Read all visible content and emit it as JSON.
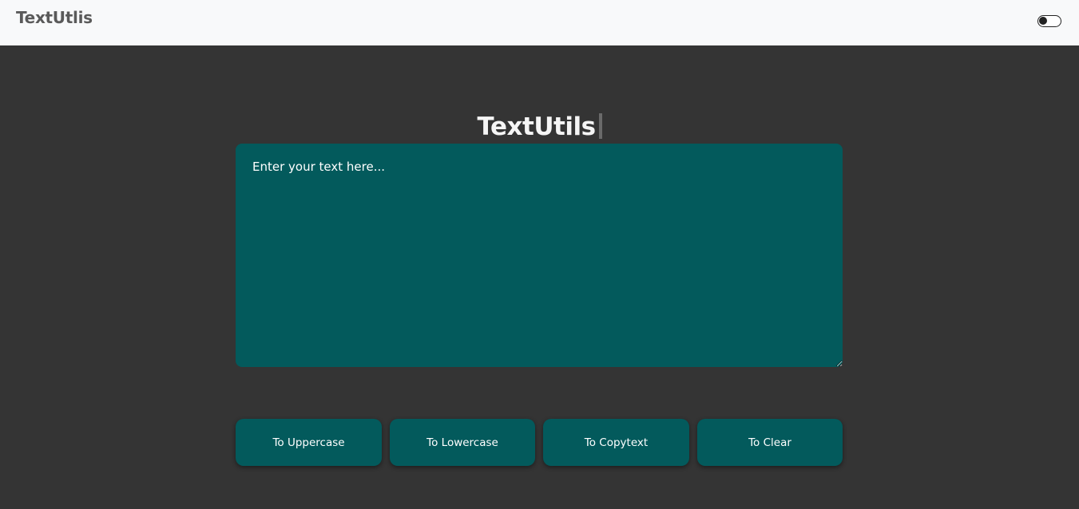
{
  "navbar": {
    "brand": "TextUtlis",
    "theme_toggle": {
      "icon": "toggle-switch-icon",
      "state": "off"
    }
  },
  "main": {
    "title": "TextUtils",
    "textarea": {
      "placeholder": "Enter your text here...",
      "value": ""
    },
    "buttons": {
      "uppercase": "To Uppercase",
      "lowercase": "To Lowercase",
      "copytext": "To Copytext",
      "clear": "To Clear"
    }
  },
  "colors": {
    "navbar_bg": "#f8f9fa",
    "page_bg": "#343434",
    "accent": "#035a5c",
    "text_light": "#ffffff"
  }
}
